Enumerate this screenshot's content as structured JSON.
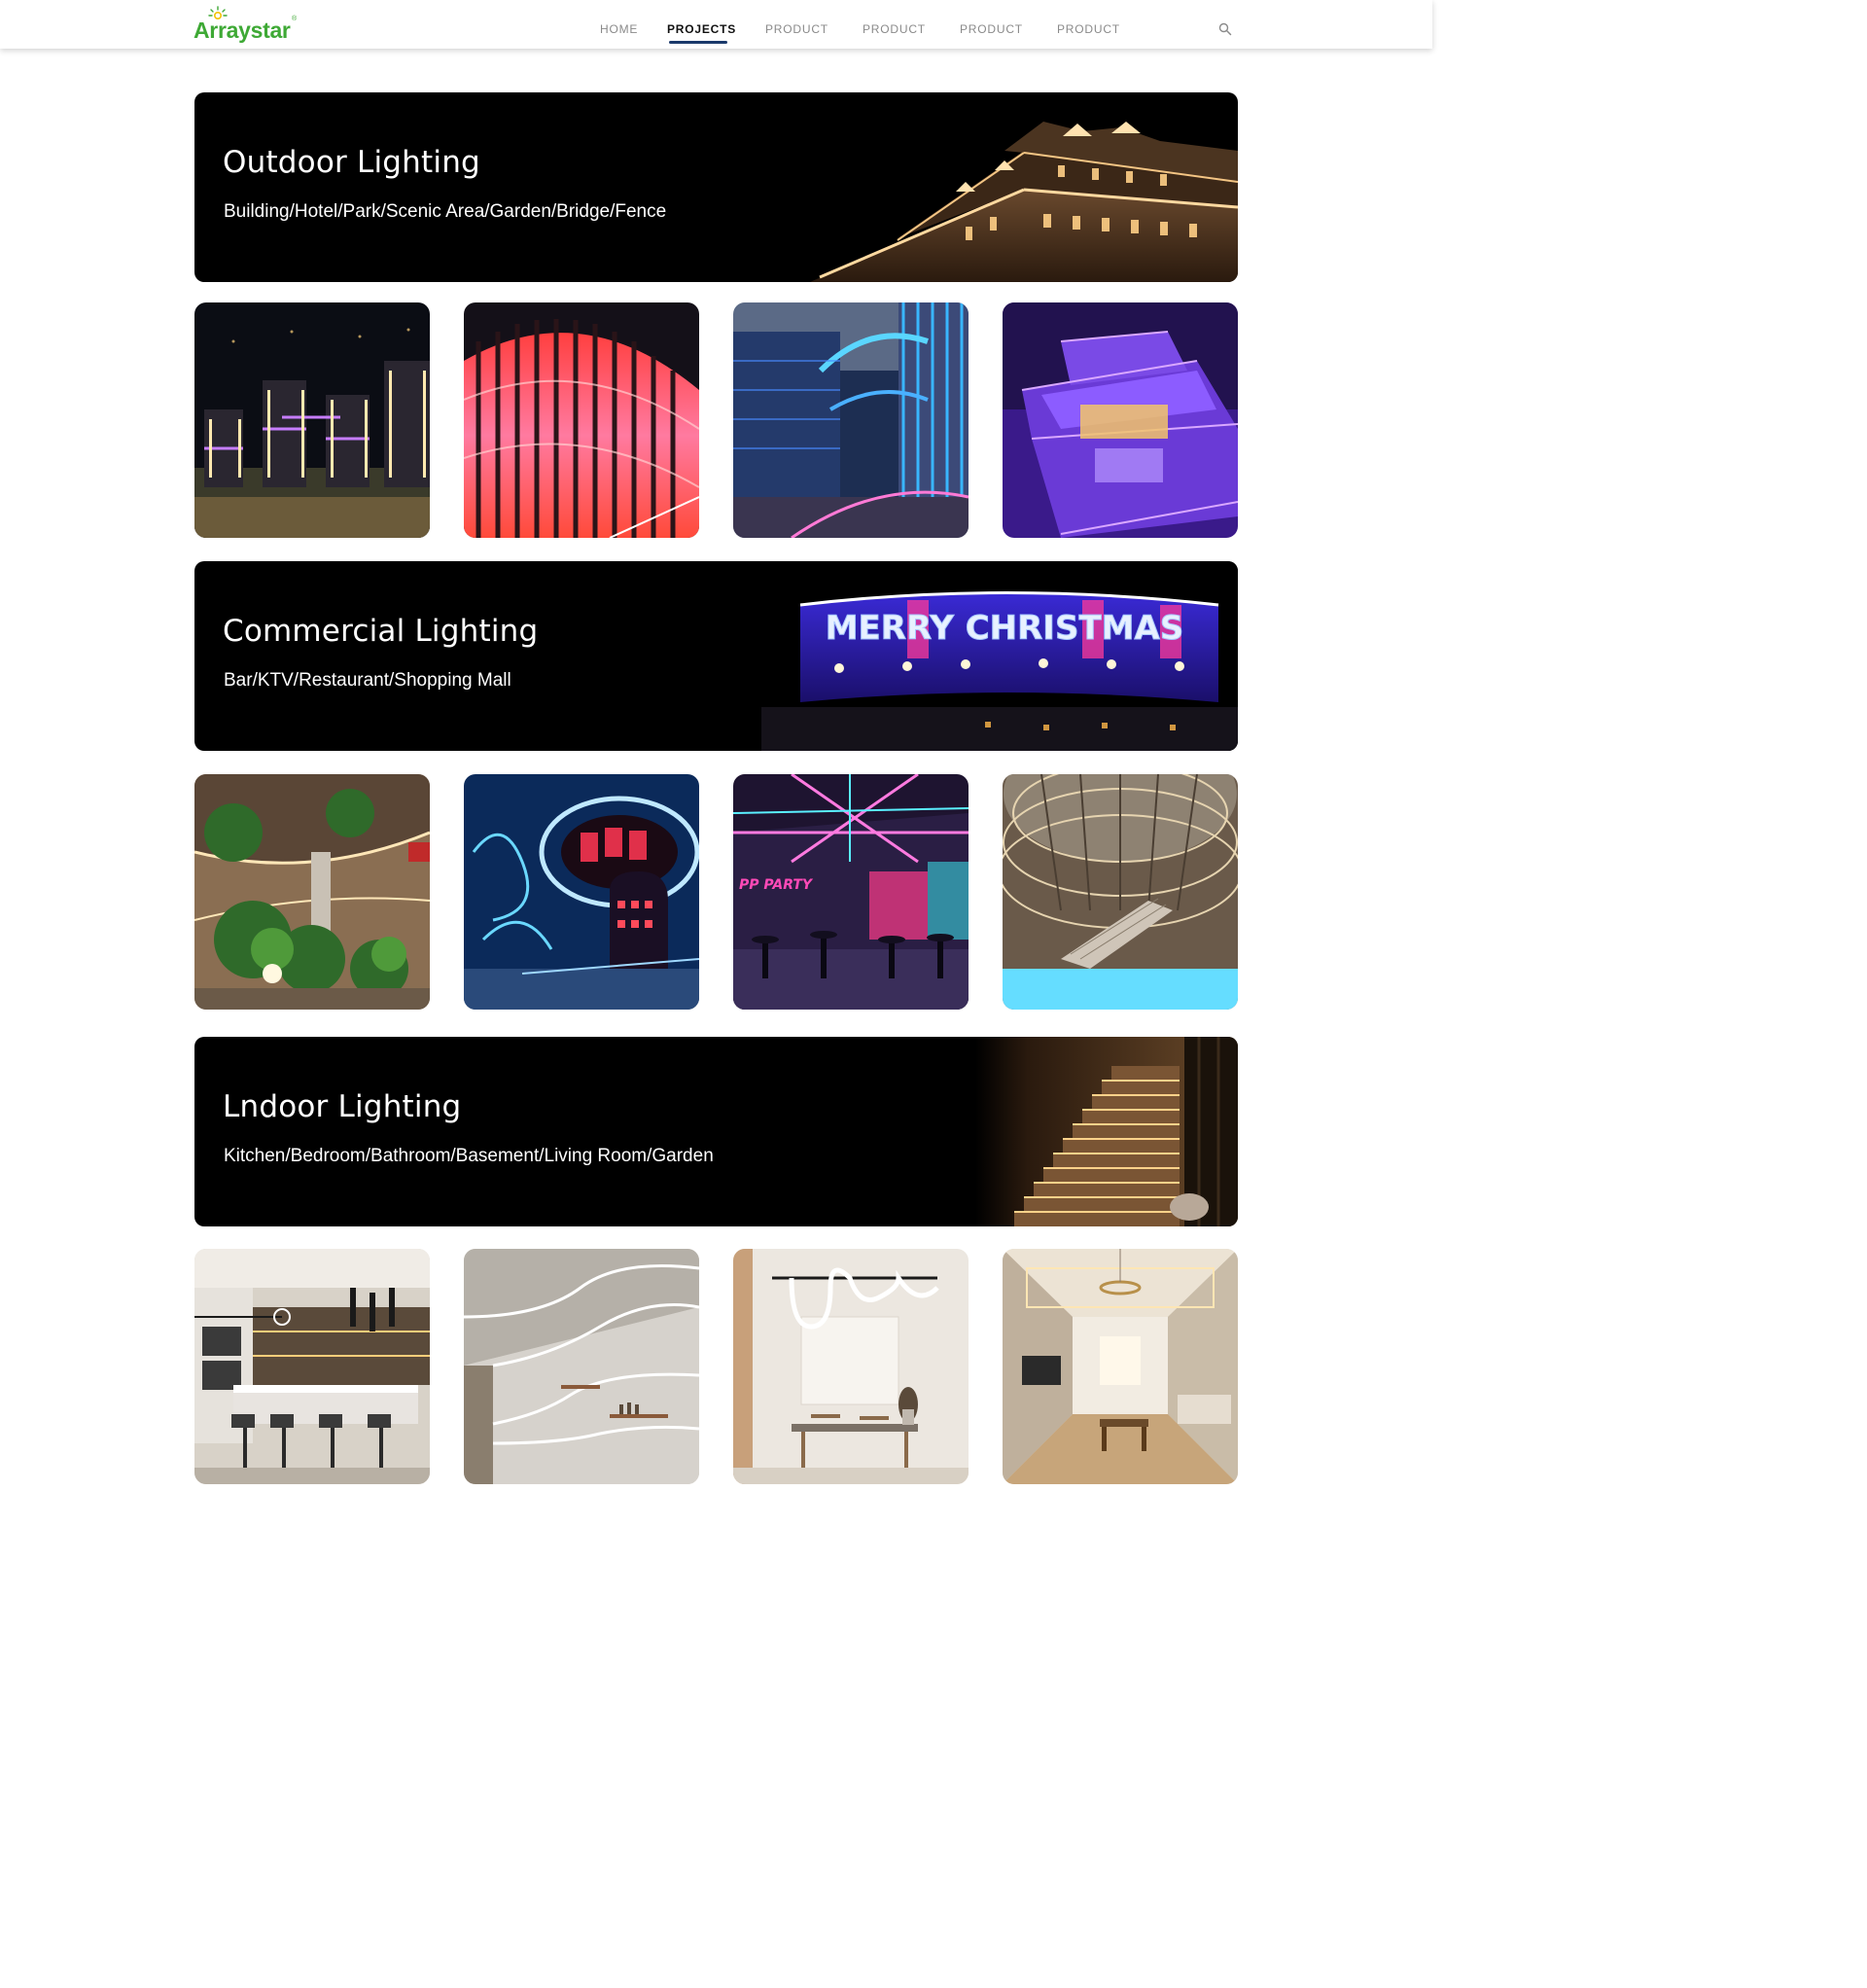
{
  "brand": {
    "name": "Arraystar",
    "registered": "®"
  },
  "nav": {
    "items": [
      {
        "label": "HOME",
        "active": false
      },
      {
        "label": "PROJECTS",
        "active": true
      },
      {
        "label": "PRODUCT",
        "active": false
      },
      {
        "label": "PRODUCT",
        "active": false
      },
      {
        "label": "PRODUCT",
        "active": false
      },
      {
        "label": "PRODUCT",
        "active": false
      }
    ],
    "search_icon": "search-icon"
  },
  "sections": [
    {
      "title": "Outdoor Lighting",
      "subtitle": "Building/Hotel/Park/Scenic Area/Garden/Bridge/Fence",
      "tiles": [
        "city-towers-purple",
        "curved-facade-red",
        "glass-building-blue",
        "yacht-purple"
      ]
    },
    {
      "title": "Commercial Lighting",
      "subtitle": "Bar/KTV/Restaurant/Shopping Mall",
      "banner_sign": "MERRY CHRISTMAS",
      "tiles": [
        "atrium-trees",
        "neon-bar-blue",
        "party-club-pink",
        "mall-atrium"
      ]
    },
    {
      "title": "Lndoor Lighting",
      "subtitle": "Kitchen/Bedroom/Bathroom/Basement/Living Room/Garden",
      "tiles": [
        "kitchen",
        "wall-light-lines",
        "dining-neon-pendant",
        "living-room"
      ]
    }
  ],
  "tile_labels": {
    "party_sign": "PP PARTY"
  },
  "colors": {
    "brand_green": "#3ea935",
    "nav_active_underline": "#1b3a6b",
    "banner_bg": "#000000"
  }
}
